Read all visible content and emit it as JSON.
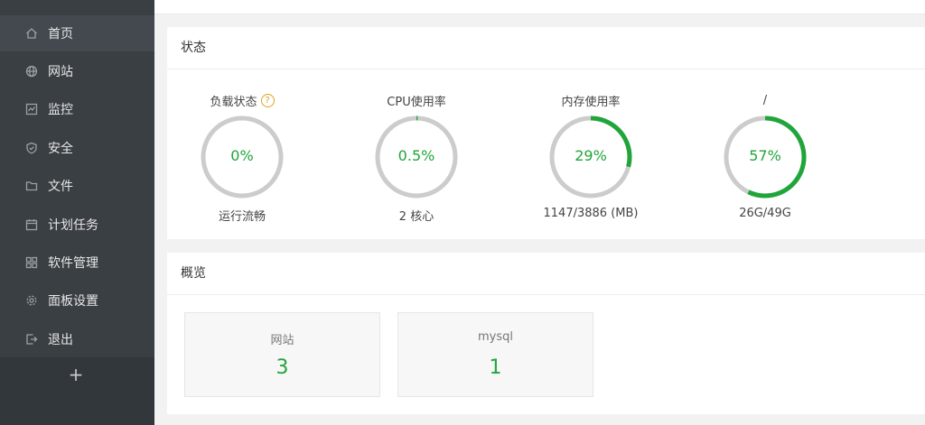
{
  "sidebar": {
    "items": [
      {
        "label": "首页",
        "icon": "home-icon"
      },
      {
        "label": "网站",
        "icon": "globe-icon"
      },
      {
        "label": "监控",
        "icon": "monitor-icon"
      },
      {
        "label": "安全",
        "icon": "shield-icon"
      },
      {
        "label": "文件",
        "icon": "folder-icon"
      },
      {
        "label": "计划任务",
        "icon": "calendar-icon"
      },
      {
        "label": "软件管理",
        "icon": "grid-icon"
      },
      {
        "label": "面板设置",
        "icon": "gear-icon"
      },
      {
        "label": "退出",
        "icon": "logout-icon"
      }
    ],
    "add_label": "+"
  },
  "status": {
    "title": "状态",
    "gauges": [
      {
        "label": "负载状态",
        "help": "?",
        "value": "0%",
        "percent": 0,
        "sub": "运行流畅"
      },
      {
        "label": "CPU使用率",
        "value": "0.5%",
        "percent": 0.5,
        "sub": "2 核心"
      },
      {
        "label": "内存使用率",
        "value": "29%",
        "percent": 29,
        "sub": "1147/3886 (MB)"
      },
      {
        "label": "/",
        "value": "57%",
        "percent": 57,
        "sub": "26G/49G"
      }
    ]
  },
  "overview": {
    "title": "概览",
    "cards": [
      {
        "name": "网站",
        "count": "3"
      },
      {
        "name": "mysql",
        "count": "1"
      }
    ]
  },
  "colors": {
    "accent": "#20a53a",
    "ring_track": "#cccccc",
    "sidebar_bg": "#3a3f44"
  }
}
